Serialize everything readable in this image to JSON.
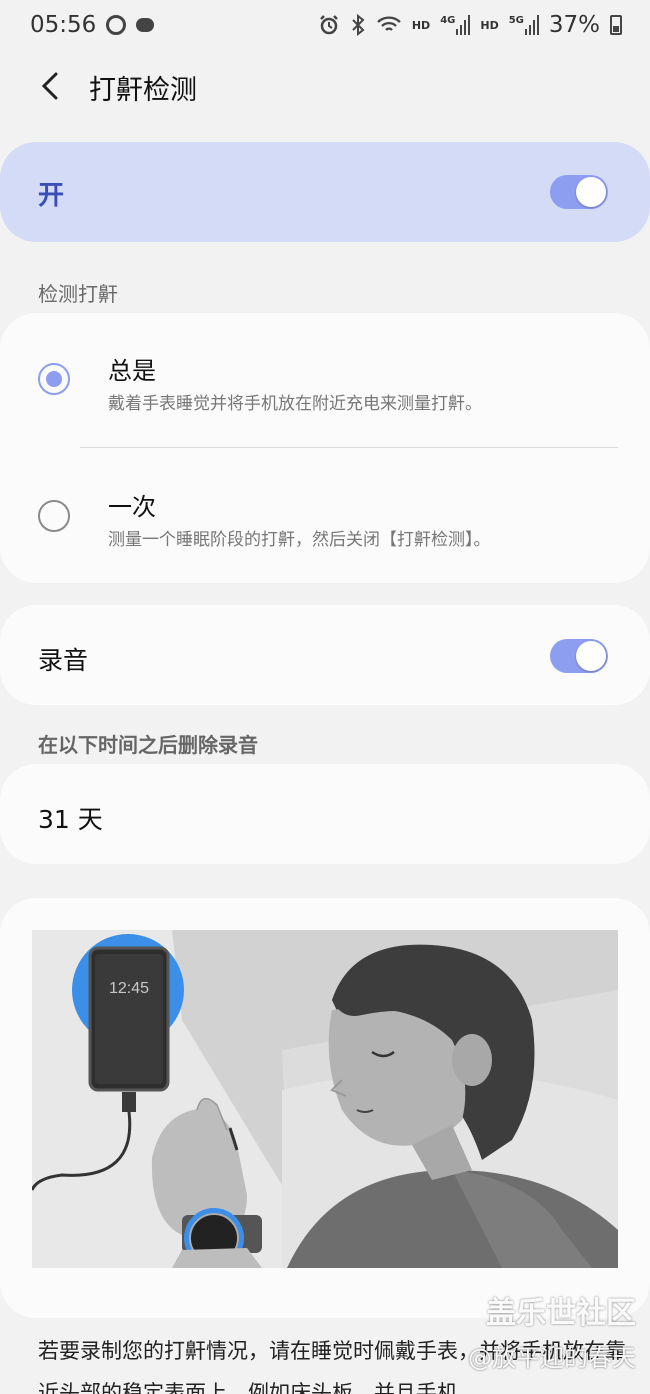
{
  "status_bar": {
    "time": "05:56",
    "hd1": "HD",
    "net1": "4G",
    "hd2": "HD",
    "net2": "5G",
    "battery": "37%"
  },
  "header": {
    "title": "打鼾检测"
  },
  "master": {
    "label": "开",
    "on": true
  },
  "detect_section": {
    "label": "检测打鼾",
    "options": [
      {
        "title": "总是",
        "desc": "戴着手表睡觉并将手机放在附近充电来测量打鼾。",
        "selected": true
      },
      {
        "title": "一次",
        "desc": "测量一个睡眠阶段的打鼾，然后关闭【打鼾检测】。",
        "selected": false
      }
    ]
  },
  "recording": {
    "label": "录音",
    "on": true
  },
  "delete_section": {
    "label": "在以下时间之后删除录音",
    "value": "31 天"
  },
  "illustration": {
    "phone_time": "12:45"
  },
  "body_text": "若要录制您的打鼾情况，请在睡觉时佩戴手表，并将手机放在靠近头部的稳定表面上，例如床头板，并且手机",
  "watermark": {
    "line1": "盖乐世社区",
    "line2": "@放平迎的春天"
  },
  "colors": {
    "accent": "#8d9df0",
    "master_bg": "#d4dbf7",
    "charger": "#3b8fe8"
  }
}
